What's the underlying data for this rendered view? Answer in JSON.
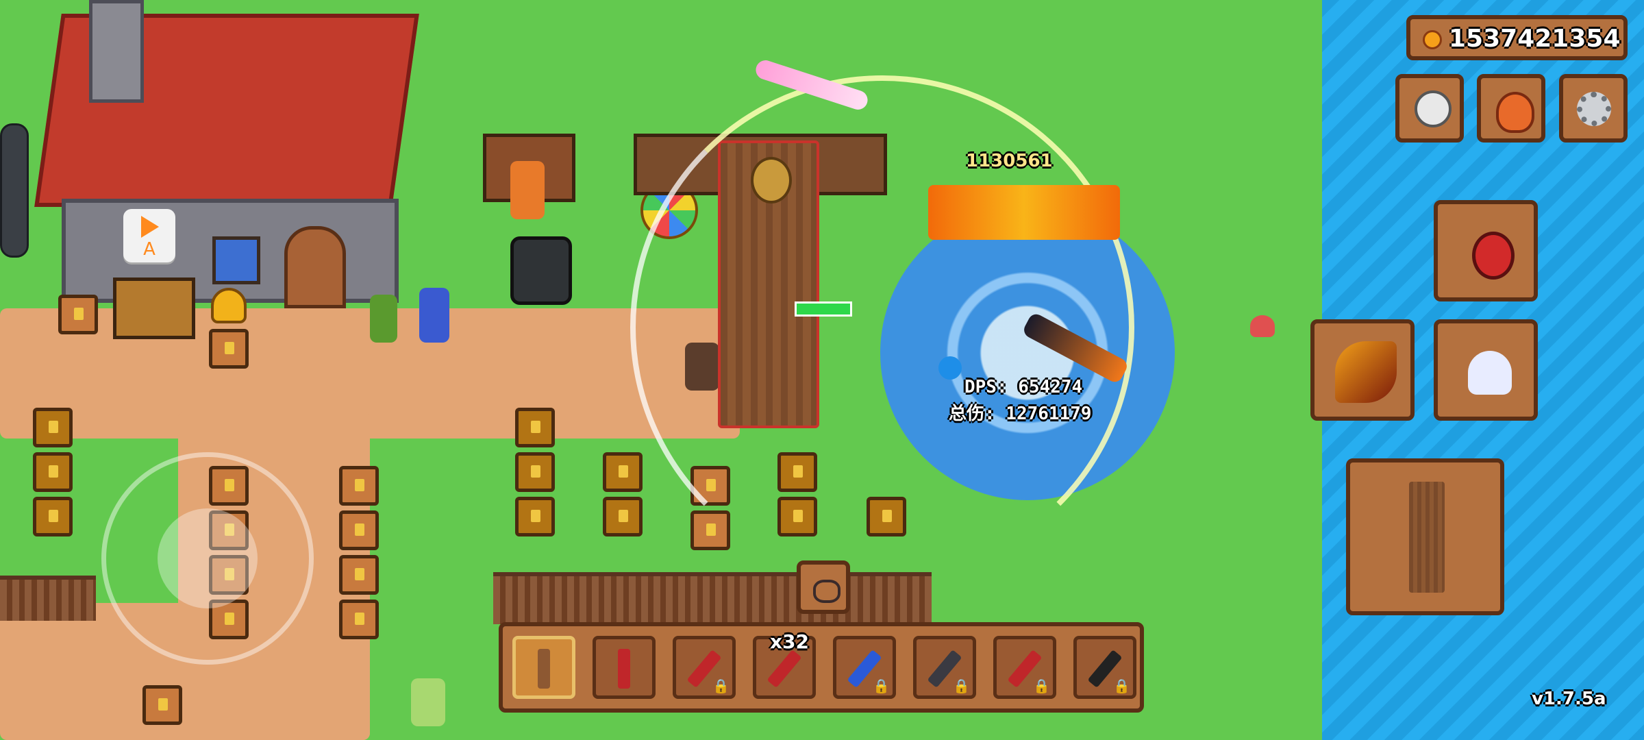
{
  "hud": {
    "gold_amount": "1537421354",
    "version": "v1.7.5a",
    "dps_label": "DPS: 654274",
    "total_damage_label": "总伤: 12761179",
    "weapon_count_badge": "x32",
    "play_button_letter": "A",
    "floating_damage": "1130561"
  },
  "top_buttons": [
    {
      "icon": "skull-icon"
    },
    {
      "icon": "loot-bag-icon"
    },
    {
      "icon": "settings-gear-icon"
    }
  ],
  "side_items": [
    {
      "icon": "health-potion-icon"
    },
    {
      "icon": "fire-claw-skill-icon"
    },
    {
      "icon": "ghost-dash-skill-icon"
    },
    {
      "icon": "training-dummy-icon"
    }
  ],
  "weapon_bar": [
    {
      "icon": "wooden-plank-weapon-icon",
      "active": true,
      "locked": false
    },
    {
      "icon": "red-blade-weapon-icon",
      "active": false,
      "locked": false
    },
    {
      "icon": "red-bow-weapon-icon",
      "active": false,
      "locked": true
    },
    {
      "icon": "red-sword-weapon-icon",
      "active": false,
      "locked": false
    },
    {
      "icon": "blue-bow-weapon-icon",
      "active": false,
      "locked": true
    },
    {
      "icon": "staff-weapon-icon",
      "active": false,
      "locked": true
    },
    {
      "icon": "red-scepter-weapon-icon",
      "active": false,
      "locked": true
    },
    {
      "icon": "dark-staff-weapon-icon",
      "active": false,
      "locked": true
    }
  ],
  "colors": {
    "grass": "#63c94f",
    "water": "#27aef0",
    "ui_wood": "#b4713f",
    "ui_border": "#5a2f16",
    "aoe_blue": "#3b8fe8"
  }
}
